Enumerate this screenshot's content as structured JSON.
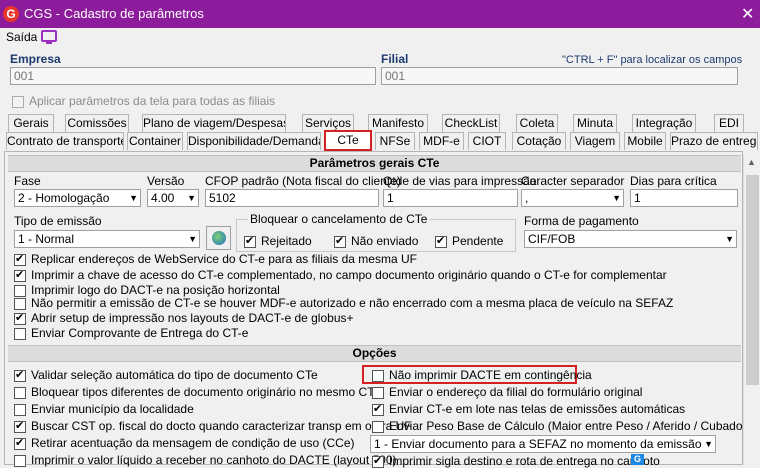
{
  "window": {
    "title": "CGS - Cadastro de parâmetros",
    "logo": "G"
  },
  "menu": {
    "saida": "Saída"
  },
  "empresa": {
    "label": "Empresa",
    "value": "001"
  },
  "filial": {
    "label": "Filial",
    "value": "001",
    "hint": "\"CTRL + F\" para localizar os campos"
  },
  "apply_all": "Aplicar parâmetros da tela para todas as filiais",
  "tabs_row1": [
    "Gerais",
    "Comissões",
    "Plano de viagem/Despesas",
    "Serviços",
    "Manifesto",
    "CheckList",
    "Coleta",
    "Minuta",
    "Integração",
    "EDI"
  ],
  "tabs_row2": [
    "Contrato de transporte",
    "Container",
    "Disponibilidade/Demanda",
    "CTe",
    "NFSe",
    "MDF-e",
    "CIOT",
    "Cotação",
    "Viagem",
    "Mobile",
    "Prazo de entrega"
  ],
  "section1": "Parâmetros gerais CTe",
  "labels": {
    "fase": "Fase",
    "versao": "Versão",
    "cfop": "CFOP padrão (Nota fiscal do cliente)",
    "vias": "Qtde de vias para impressão",
    "separador": "Caracter separador",
    "dias": "Dias para crítica",
    "tipo_emissao": "Tipo de emissão",
    "bloquear": "Bloquear o cancelamento de CTe",
    "forma_pagamento": "Forma de pagamento"
  },
  "values": {
    "fase": "2 - Homologação",
    "versao": "4.00",
    "cfop": "5102",
    "vias": "1",
    "separador": ",",
    "dias": "1",
    "tipo_emissao": "1 - Normal",
    "forma_pagamento": "CIF/FOB"
  },
  "bloquear_opts": [
    "Rejeitado",
    "Não enviado",
    "Pendente"
  ],
  "general_checks": [
    "Replicar endereços de WebService do CT-e para as filiais da mesma UF",
    "Imprimir a chave de acesso do CT-e complementado, no campo documento originário quando o CT-e for complementar",
    "Imprimir logo do DACT-e na posição horizontal",
    "Não permitir a emissão de CT-e se houver MDF-e autorizado e não encerrado com a mesma placa de veículo na SEFAZ",
    "Abrir setup de impressão nos layouts de DACT-e de globus+",
    "Enviar Comprovante de Entrega do CT-e"
  ],
  "section2": "Opções",
  "options_left": [
    "Validar seleção automática do tipo de documento CTe",
    "Bloquear tipos diferentes de documento originário no mesmo CTe",
    "Enviar município da localidade",
    "Buscar CST op. fiscal do docto quando caracterizar transp em outra UF",
    "Retirar acentuação da mensagem de condição de uso (CCe)",
    "Imprimir o valor líquido a receber no canhoto do DACTE (layout 500)"
  ],
  "options_right": [
    "Não imprimir DACTE em contingência",
    "Enviar o endereço da filial do formulário original",
    "Enviar CT-e em lote nas telas de emissões automáticas",
    "Enviar Peso Base de Cálculo (Maior entre Peso / Aferido / Cubado)"
  ],
  "envio_select": "1 - Enviar documento para a SEFAZ no momento da emissão",
  "last_right": "Imprimir sigla destino e rota de entrega no canhoto"
}
